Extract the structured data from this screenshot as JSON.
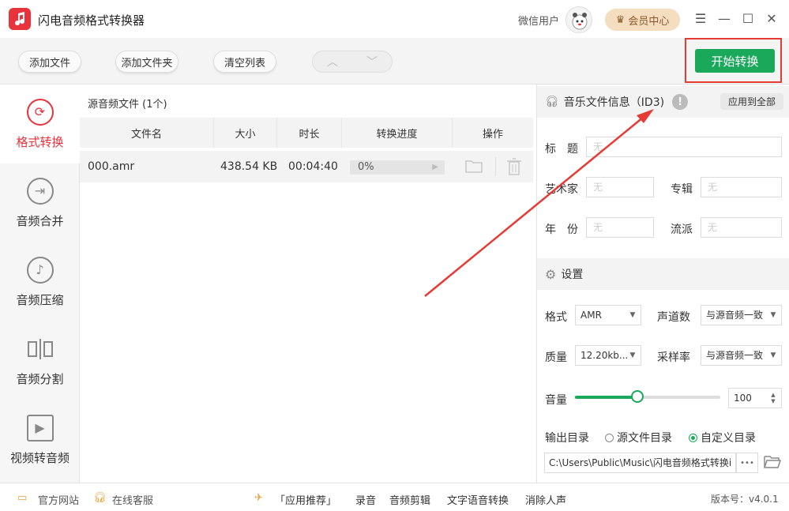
{
  "app": {
    "title": "闪电音频格式转换器",
    "user": "微信用户",
    "vip_label": "会员中心"
  },
  "toolbar": {
    "add_file": "添加文件",
    "add_folder": "添加文件夹",
    "clear_list": "清空列表",
    "start": "开始转换"
  },
  "sidebar": {
    "items": [
      {
        "label": "格式转换",
        "icon": "refresh-icon",
        "active": true
      },
      {
        "label": "音频合并",
        "icon": "merge-icon",
        "active": false
      },
      {
        "label": "音频压缩",
        "icon": "music-note-icon",
        "active": false
      },
      {
        "label": "音频分割",
        "icon": "split-icon",
        "active": false
      },
      {
        "label": "视频转音频",
        "icon": "play-icon",
        "active": false
      }
    ]
  },
  "files": {
    "count_label": "源音频文件 (1个)",
    "columns": [
      "文件名",
      "大小",
      "时长",
      "转换进度",
      "操作"
    ],
    "rows": [
      {
        "name": "000.amr",
        "size": "438.54 KB",
        "duration": "00:04:40",
        "progress": "0%"
      }
    ]
  },
  "id3": {
    "title": "音乐文件信息（ID3)",
    "apply_all": "应用到全部",
    "fields": {
      "title_label": "标　题",
      "artist_label": "艺术家",
      "album_label": "专辑",
      "year_label": "年　份",
      "genre_label": "流派",
      "placeholder": "无"
    }
  },
  "settings": {
    "title": "设置",
    "format_label": "格式",
    "format_value": "AMR",
    "channels_label": "声道数",
    "channels_value": "与源音频一致",
    "quality_label": "质量",
    "quality_value": "12.20kb...",
    "samplerate_label": "采样率",
    "samplerate_value": "与源音频一致",
    "volume_label": "音量",
    "volume_value": "100",
    "volume_level": 0.43,
    "output_label": "输出目录",
    "radio_source": "源文件目录",
    "radio_custom": "自定义目录",
    "radio_selected": "custom",
    "output_path": "C:\\Users\\Public\\Music\\闪电音频格式转换i",
    "more": "•••"
  },
  "statusbar": {
    "website": "官方网站",
    "service": "在线客服",
    "recommend": "「应用推荐」",
    "record": "录音",
    "edit": "音频剪辑",
    "tts": "文字语音转换",
    "vocal": "消除人声",
    "version": "版本号：v4.0.1"
  },
  "colors": {
    "accent_red": "#e8323c",
    "start_green": "#1aa85b",
    "slider_green": "#1aa85b",
    "vip_gold": "#f5ddbf"
  }
}
